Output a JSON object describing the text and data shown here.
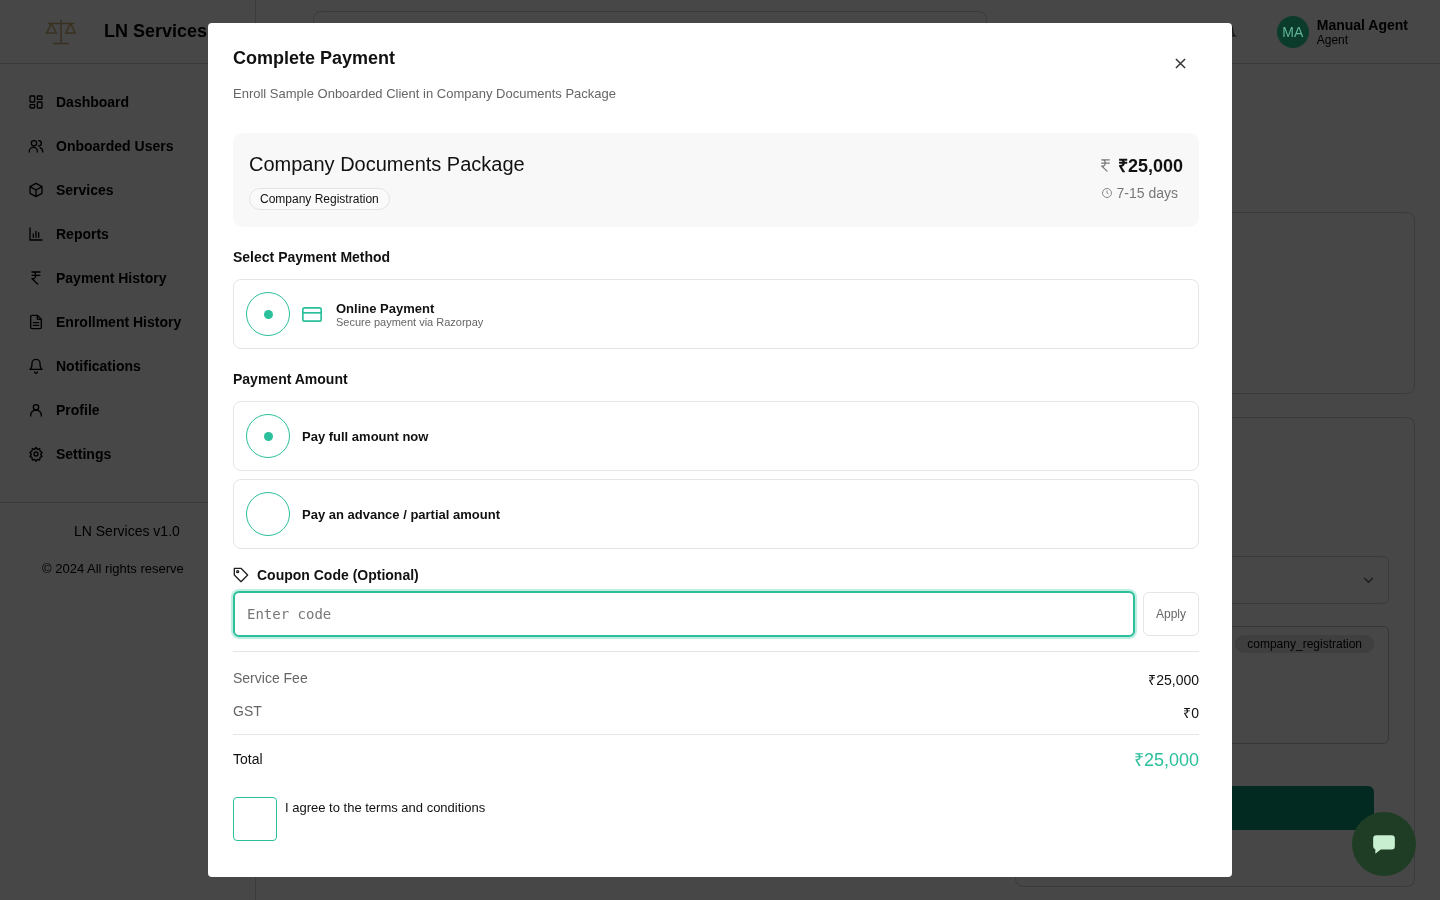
{
  "brand": {
    "name": "LN Services"
  },
  "sidebar": {
    "items": [
      {
        "label": "Dashboard"
      },
      {
        "label": "Onboarded Users"
      },
      {
        "label": "Services"
      },
      {
        "label": "Reports"
      },
      {
        "label": "Payment History"
      },
      {
        "label": "Enrollment History"
      },
      {
        "label": "Notifications"
      },
      {
        "label": "Profile"
      },
      {
        "label": "Settings"
      }
    ],
    "version": "LN Services v1.0",
    "copyright": "© 2024 All rights reserve"
  },
  "header": {
    "initials": "MA",
    "user_name": "Manual Agent",
    "role": "Agent"
  },
  "background": {
    "tag": "company_registration"
  },
  "modal": {
    "title": "Complete Payment",
    "subtitle": "Enroll Sample Onboarded Client in Company Documents Package",
    "package": {
      "name": "Company Documents Package",
      "category": "Company Registration",
      "price": "₹25,000",
      "duration": "7-15 days"
    },
    "payment_method": {
      "heading": "Select Payment Method",
      "options": [
        {
          "title": "Online Payment",
          "subtitle": "Secure payment via Razorpay",
          "selected": true
        }
      ]
    },
    "payment_amount": {
      "heading": "Payment Amount",
      "options": [
        {
          "label": "Pay full amount now",
          "selected": true
        },
        {
          "label": "Pay an advance / partial amount",
          "selected": false
        }
      ]
    },
    "coupon": {
      "label": "Coupon Code (Optional)",
      "placeholder": "Enter code",
      "button": "Apply"
    },
    "summary": [
      {
        "label": "Service Fee",
        "value": "₹25,000"
      },
      {
        "label": "GST",
        "value": "₹0"
      }
    ],
    "total": {
      "label": "Total",
      "value": "₹25,000"
    },
    "terms": {
      "label": "I agree to the terms and conditions",
      "checked": false
    }
  }
}
